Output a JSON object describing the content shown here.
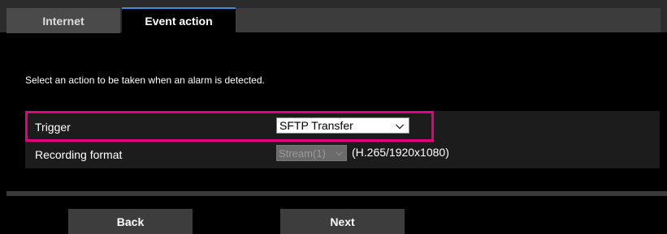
{
  "tabs": [
    {
      "label": "Internet"
    },
    {
      "label": "Event action"
    }
  ],
  "description": "Select an action to be taken when an alarm is detected.",
  "trigger": {
    "label": "Trigger",
    "selected": "SFTP Transfer"
  },
  "recording_format": {
    "label": "Recording format",
    "selected": "Stream(1)",
    "info": "(H.265/1920x1080)"
  },
  "buttons": {
    "back": "Back",
    "next": "Next"
  },
  "colors": {
    "highlight": "#e4007f",
    "background": "#000000",
    "active_tab_accent": "#3a8fe0"
  }
}
